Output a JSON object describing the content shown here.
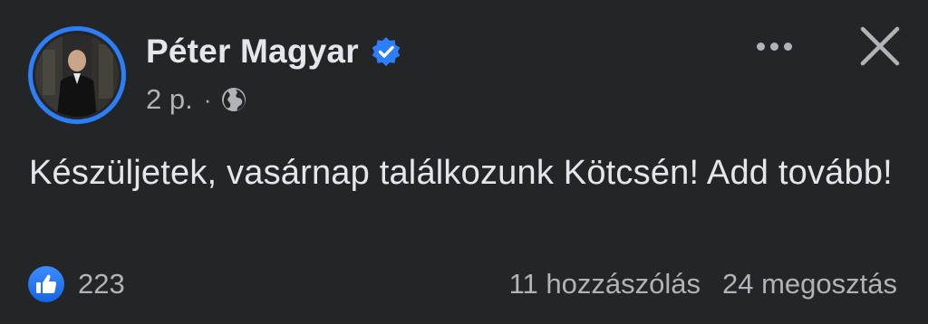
{
  "post": {
    "author": {
      "name": "Péter Magyar",
      "verified": true
    },
    "timestamp": "2 p.",
    "separator": "·",
    "audience_icon": "globe-icon",
    "text": "Készüljetek, vasárnap találkozunk Kötcsén! Add tovább!",
    "reactions": {
      "icon": "like-icon",
      "count": "223"
    },
    "comments_label": "11 hozzászólás",
    "shares_label": "24 megosztás"
  },
  "colors": {
    "background": "#242526",
    "primary_text": "#e4e6eb",
    "secondary_text": "#b0b3b8",
    "accent": "#2d7ff9"
  }
}
